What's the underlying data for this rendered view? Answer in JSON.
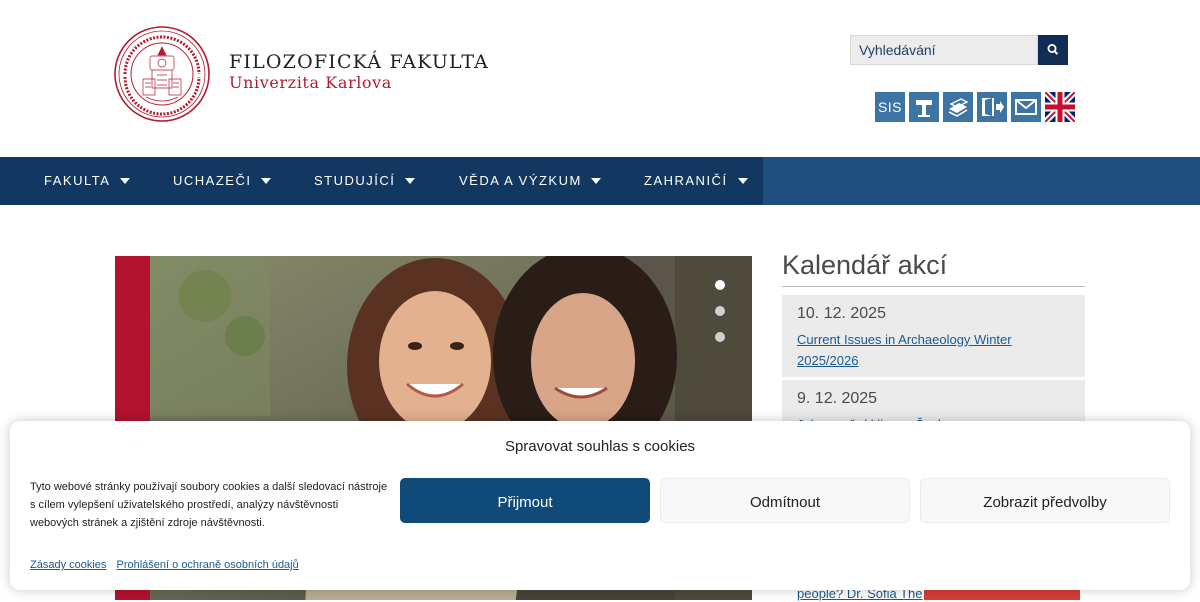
{
  "header": {
    "title": "FILOZOFICKÁ FAKULTA",
    "subtitle": "Univerzita Karlova",
    "search": {
      "placeholder": "Vyhledávání"
    },
    "quick_links": [
      {
        "label": "SIS",
        "icon": "sis-text"
      },
      {
        "label": "",
        "icon": "id-card-icon"
      },
      {
        "label": "",
        "icon": "books-icon"
      },
      {
        "label": "",
        "icon": "login-door-icon"
      },
      {
        "label": "",
        "icon": "envelope-icon"
      },
      {
        "label": "",
        "icon": "uk-flag-icon"
      }
    ]
  },
  "nav": {
    "items": [
      {
        "label": "FAKULTA"
      },
      {
        "label": "UCHAZEČI"
      },
      {
        "label": "STUDUJÍCÍ"
      },
      {
        "label": "VĚDA A VÝZKUM"
      },
      {
        "label": "ZAHRANIČÍ"
      }
    ]
  },
  "calendar": {
    "title": "Kalendář akcí",
    "events": [
      {
        "date": "10. 12. 2025",
        "title": "Current Issues in Archaeology Winter 2025/2026"
      },
      {
        "date": "9. 12. 2025",
        "title": "Jak se mění klima v Česku"
      }
    ],
    "partial_text": "people? Dr. Sofia The"
  },
  "cookie": {
    "title": "Spravovat souhlas s cookies",
    "text": "Tyto webové stránky používají soubory cookies a další sledovací nástroje s cílem vylepšení uživatelského prostředí, analýzy návštěvnosti webových stránek a zjištění zdroje návštěvnosti.",
    "accept_label": "Přijmout",
    "deny_label": "Odmítnout",
    "prefs_label": "Zobrazit předvolby",
    "links": [
      "Zásady cookies",
      "Prohlášení o ochraně osobních údajů"
    ]
  },
  "colors": {
    "brand_red": "#b11b30",
    "nav_dark": "#123862",
    "nav_bar": "#1e4e7c",
    "accept_blue": "#0f4a78",
    "quick_link_blue": "#3d74a3"
  }
}
